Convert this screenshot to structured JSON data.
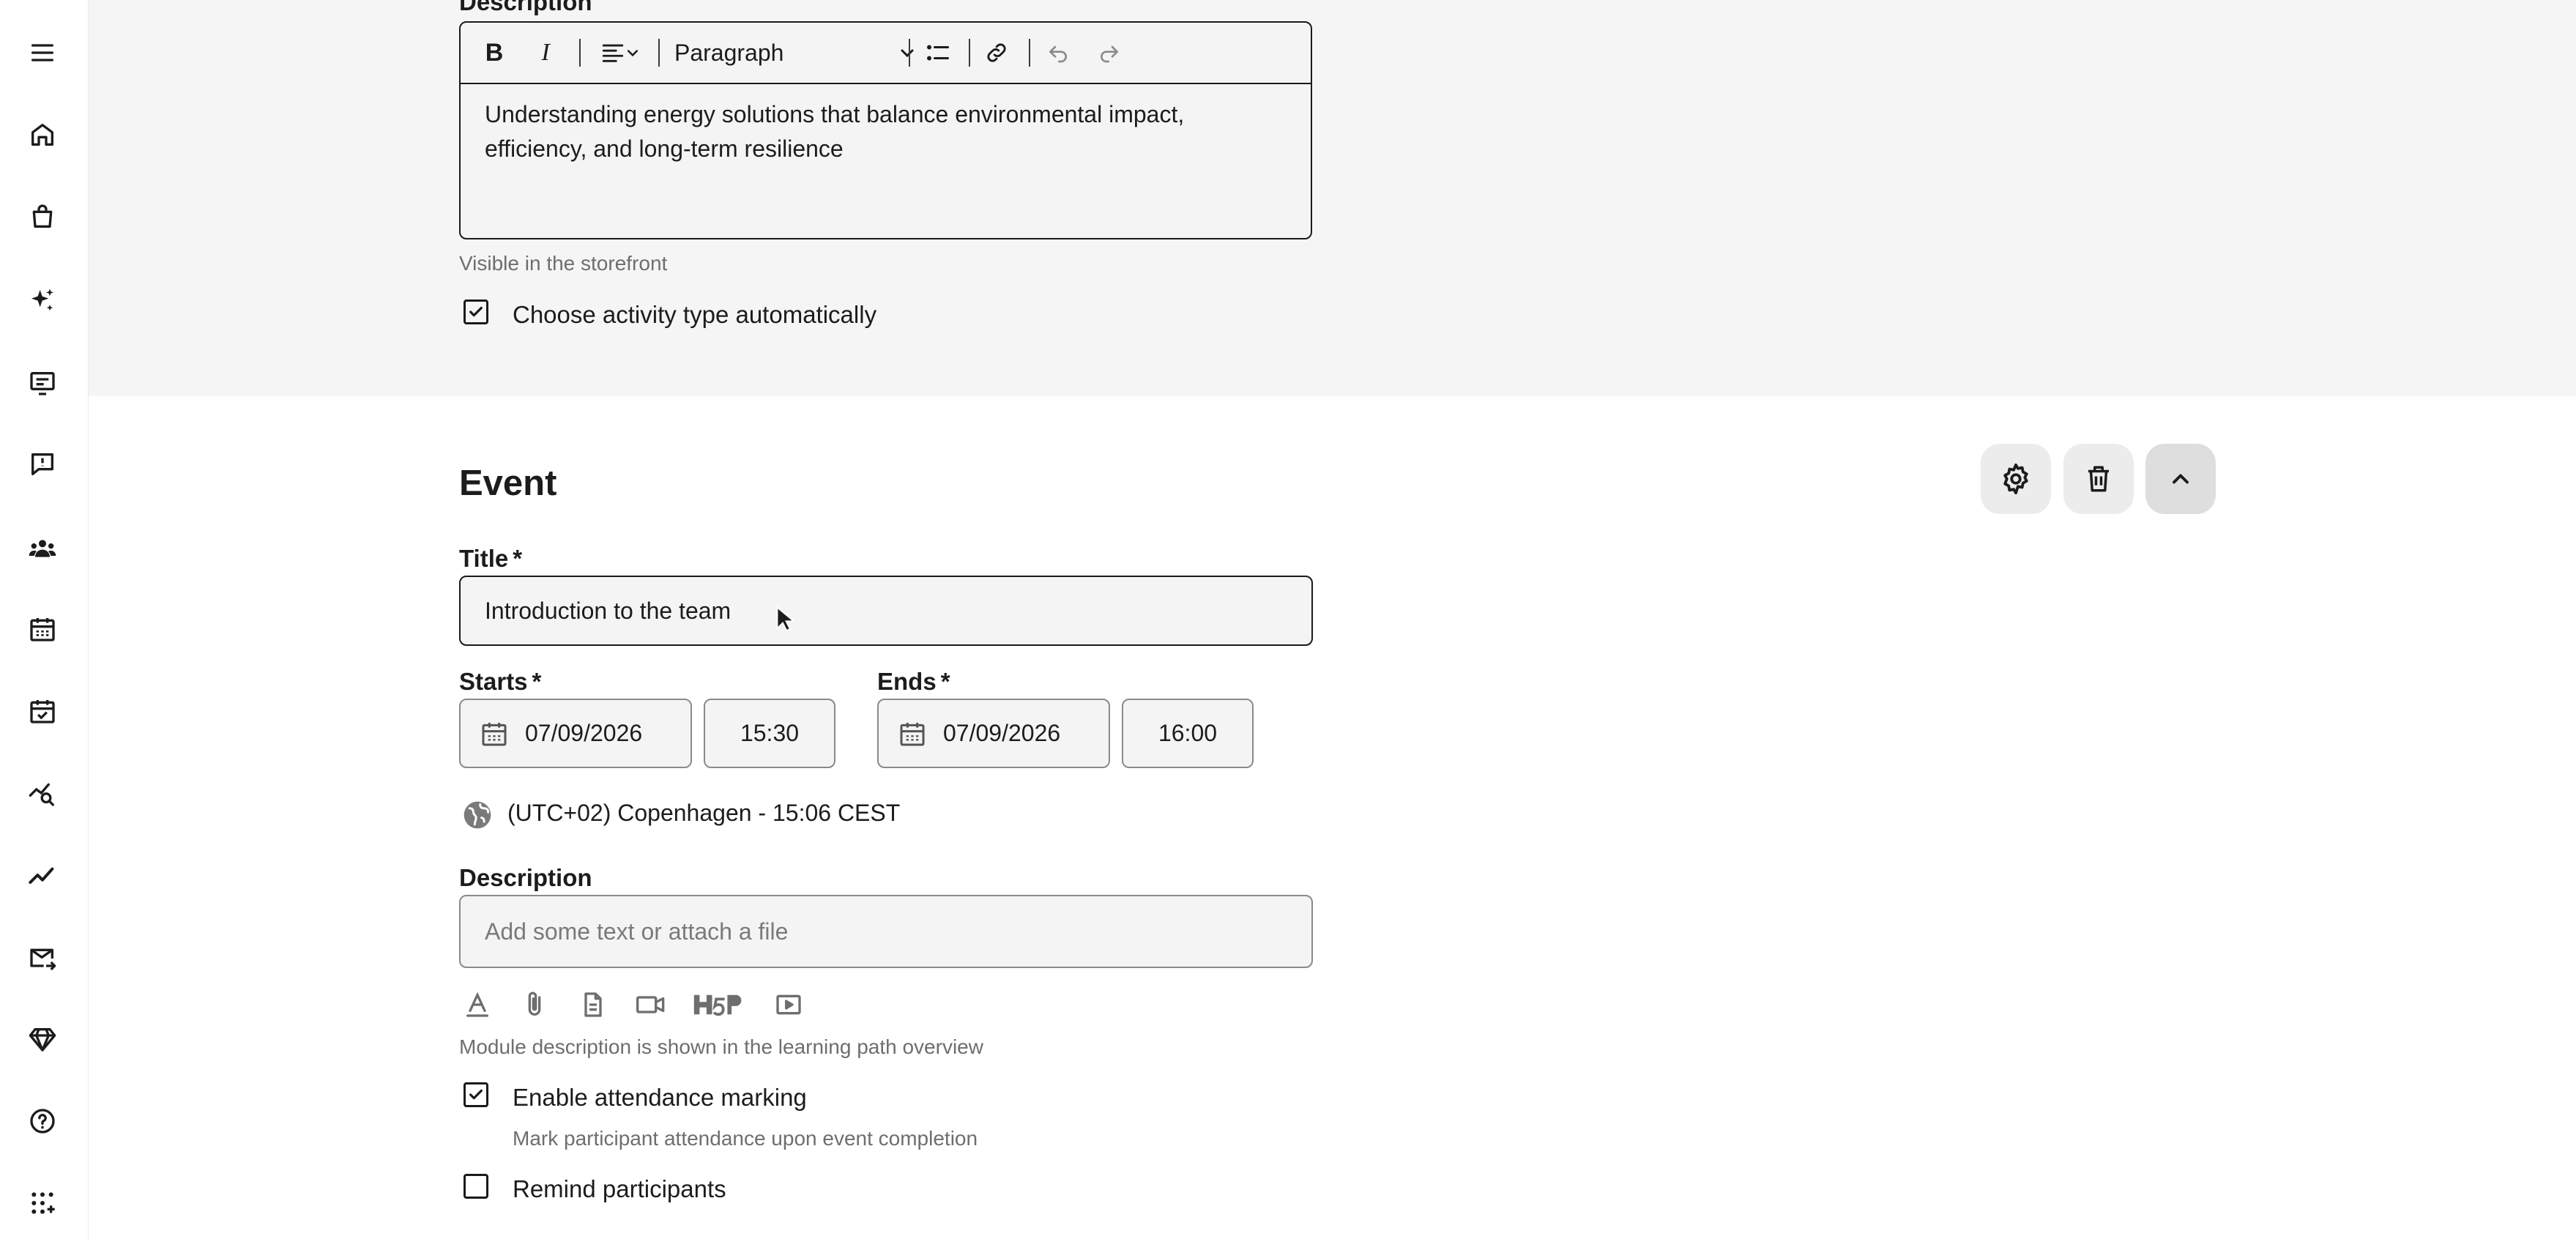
{
  "sidebar": {
    "items": [
      {
        "icon": "menu-icon"
      },
      {
        "icon": "home-icon"
      },
      {
        "icon": "shopping-bag-icon"
      },
      {
        "icon": "sparkles-icon"
      },
      {
        "icon": "presentation-icon"
      },
      {
        "icon": "feedback-icon"
      },
      {
        "icon": "users-icon"
      },
      {
        "icon": "calendar-icon"
      },
      {
        "icon": "calendar-check-icon"
      },
      {
        "icon": "analytics-search-icon"
      },
      {
        "icon": "trend-line-icon"
      },
      {
        "icon": "mail-send-icon"
      },
      {
        "icon": "diamond-icon"
      },
      {
        "icon": "help-icon"
      },
      {
        "icon": "apps-grid-icon"
      }
    ]
  },
  "course_description": {
    "label": "Description",
    "toolbar": {
      "bold": "B",
      "italic": "I",
      "block_format": "Paragraph"
    },
    "text": "Understanding energy solutions that balance environmental impact, efficiency, and long-term resilience",
    "hint": "Visible in the storefront",
    "auto_activity_checkbox": {
      "label": "Choose activity type automatically",
      "checked": true
    }
  },
  "event": {
    "heading": "Event",
    "title_label": "Title",
    "required_mark": "*",
    "title_value": "Introduction to the team",
    "starts_label": "Starts",
    "starts_date": "07/09/2026",
    "starts_time": "15:30",
    "ends_label": "Ends",
    "ends_date": "07/09/2026",
    "ends_time": "16:00",
    "timezone": "(UTC+02) Copenhagen - 15:06 CEST",
    "description_label": "Description",
    "description_placeholder": "Add some text or attach a file",
    "description_hint": "Module description is shown in the learning path overview",
    "attendance_checkbox": {
      "label": "Enable attendance marking",
      "checked": true
    },
    "attendance_hint": "Mark participant attendance upon event completion",
    "remind_checkbox": {
      "label": "Remind participants",
      "checked": false
    }
  }
}
